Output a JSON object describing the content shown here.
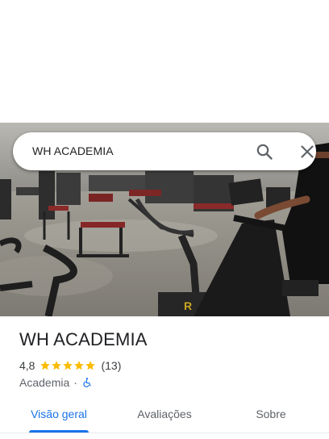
{
  "search": {
    "query": "WH ACADEMIA",
    "search_icon": "search-icon",
    "close_icon": "close-icon"
  },
  "place": {
    "name": "WH ACADEMIA",
    "rating": "4,8",
    "stars": 5,
    "reviews": "(13)",
    "category": "Academia",
    "separator": "·",
    "accessibility_icon": "wheelchair-icon"
  },
  "tabs": [
    {
      "label": "Visão geral",
      "active": true
    },
    {
      "label": "Avaliações",
      "active": false
    },
    {
      "label": "Sobre",
      "active": false
    }
  ],
  "colors": {
    "accent": "#1a73e8",
    "star": "#fbbc04"
  }
}
